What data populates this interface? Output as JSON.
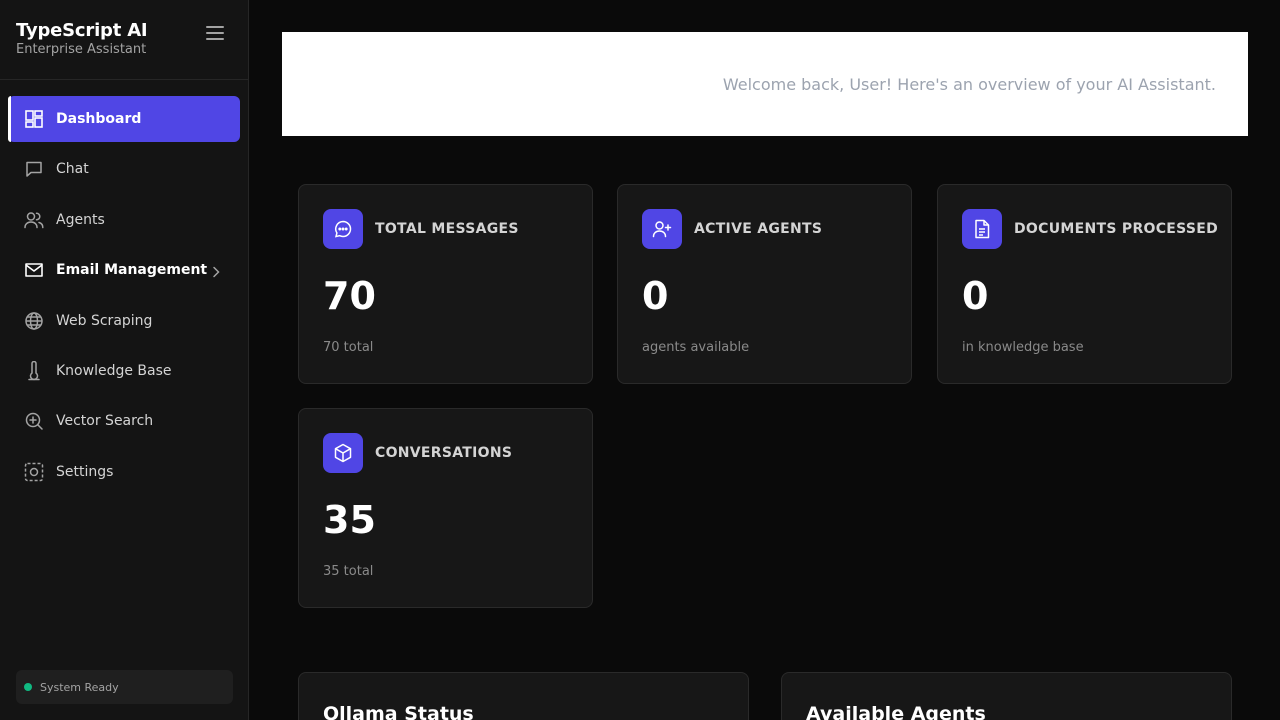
{
  "sidebar": {
    "brand_title": "TypeScript AI",
    "brand_subtitle": "Enterprise Assistant",
    "items": [
      {
        "label": "Dashboard",
        "icon": "dashboard-icon"
      },
      {
        "label": "Chat",
        "icon": "chat-icon"
      },
      {
        "label": "Agents",
        "icon": "users-icon"
      },
      {
        "label": "Email Management",
        "icon": "mail-icon"
      },
      {
        "label": "Web Scraping",
        "icon": "globe-icon"
      },
      {
        "label": "Knowledge Base",
        "icon": "thermometer-icon"
      },
      {
        "label": "Vector Search",
        "icon": "zoom-in-icon"
      },
      {
        "label": "Settings",
        "icon": "gear-icon"
      }
    ],
    "status": "System Ready"
  },
  "header": {
    "welcome": "Welcome back, User! Here's an overview of your AI Assistant."
  },
  "stats": [
    {
      "title": "TOTAL MESSAGES",
      "value": "70",
      "sub": "70 total",
      "icon": "message-icon"
    },
    {
      "title": "ACTIVE AGENTS",
      "value": "0",
      "sub": "agents available",
      "icon": "user-plus-icon"
    },
    {
      "title": "DOCUMENTS PROCESSED",
      "value": "0",
      "sub": "in knowledge base",
      "icon": "document-icon"
    },
    {
      "title": "CONVERSATIONS",
      "value": "35",
      "sub": "35 total",
      "icon": "cube-icon"
    }
  ],
  "panels": {
    "ollama_title": "Ollama Status",
    "agents_title": "Available Agents"
  },
  "colors": {
    "accent": "#5046e5",
    "status_green": "#10b981",
    "background": "#0a0a0a",
    "card": "#171717"
  }
}
